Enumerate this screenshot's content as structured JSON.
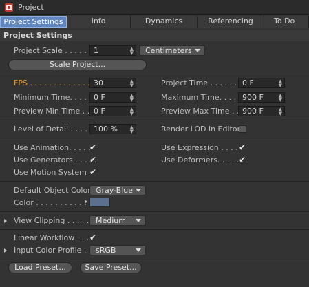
{
  "window": {
    "title": "Project",
    "icon": "project-icon"
  },
  "tabs": [
    {
      "label": "Project Settings",
      "active": true
    },
    {
      "label": "Info"
    },
    {
      "label": "Dynamics"
    },
    {
      "label": "Referencing"
    },
    {
      "label": "To Do"
    }
  ],
  "section": {
    "title": "Project Settings"
  },
  "project_scale": {
    "label": "Project Scale . . . . . .",
    "value": "1",
    "unit": "Centimeters"
  },
  "scale_project_button": "Scale Project...",
  "fps": {
    "label": "FPS . . . . . . . . . . . . . .",
    "value": "30"
  },
  "project_time": {
    "label": "Project Time . . . . . . . .",
    "value": "0 F"
  },
  "minimum_time": {
    "label": "Minimum Time. . . . . . .",
    "value": "0 F"
  },
  "maximum_time": {
    "label": "Maximum Time. . . . . . .",
    "value": "900 F"
  },
  "preview_min_time": {
    "label": "Preview Min Time . .",
    "value": "0 F"
  },
  "preview_max_time": {
    "label": "Preview Max Time . .",
    "value": "900 F"
  },
  "level_of_detail": {
    "label": "Level of Detail . . . . .",
    "value": "100 %"
  },
  "render_lod": {
    "label": "Render LOD in Editor",
    "checked": false
  },
  "use_animation": {
    "label": "Use Animation. . . . .",
    "checked": true
  },
  "use_expression": {
    "label": "Use Expression . . . . .",
    "checked": true
  },
  "use_generators": {
    "label": "Use Generators . . . . .",
    "checked": true
  },
  "use_deformers": {
    "label": "Use Deformers. . . . . .",
    "checked": true
  },
  "use_motion_system": {
    "label": "Use Motion System",
    "checked": true
  },
  "default_object_color": {
    "label": "Default Object Color",
    "value": "Gray-Blue"
  },
  "color": {
    "label": "Color . . . . . . . . . . .",
    "swatch": "#5c6f8c"
  },
  "view_clipping": {
    "label": "View Clipping . . . . . . .",
    "value": "Medium"
  },
  "linear_workflow": {
    "label": "Linear Workflow . . . .",
    "checked": true
  },
  "input_color_profile": {
    "label": "Input Color Profile .",
    "value": "sRGB"
  },
  "load_preset_button": "Load Preset...",
  "save_preset_button": "Save Preset...",
  "check_glyph": "✔",
  "spin_up_glyph": "▲",
  "spin_down_glyph": "▼",
  "colors": {
    "accent_tab": "#5f86c0",
    "fps_label": "#e49a2c",
    "background": "#333333"
  }
}
